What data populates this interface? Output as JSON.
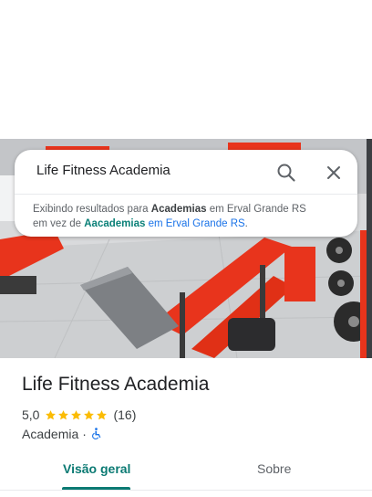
{
  "search": {
    "query": "Life Fitness Academia",
    "suggestion_prefix": "Exibindo resultados para ",
    "suggestion_term": "Academias",
    "suggestion_location": " em Erval Grande RS",
    "suggestion_mid": "em vez de ",
    "original_term": "Aacademias",
    "original_location": " em Erval Grande RS",
    "suggestion_end": "."
  },
  "place": {
    "name": "Life Fitness Academia",
    "rating": "5,0",
    "stars": 5,
    "review_count": "(16)",
    "category": "Academia",
    "separator": "·"
  },
  "tabs": [
    {
      "label": "Visão geral",
      "active": true
    },
    {
      "label": "Sobre",
      "active": false
    }
  ],
  "colors": {
    "accent": "#0b7a73",
    "star": "#fbbc04",
    "link": "#1a73e8",
    "equipment": "#e8341c"
  },
  "icons": {
    "search": "search-icon",
    "close": "close-icon",
    "star": "star-icon",
    "accessible": "wheelchair-icon"
  }
}
